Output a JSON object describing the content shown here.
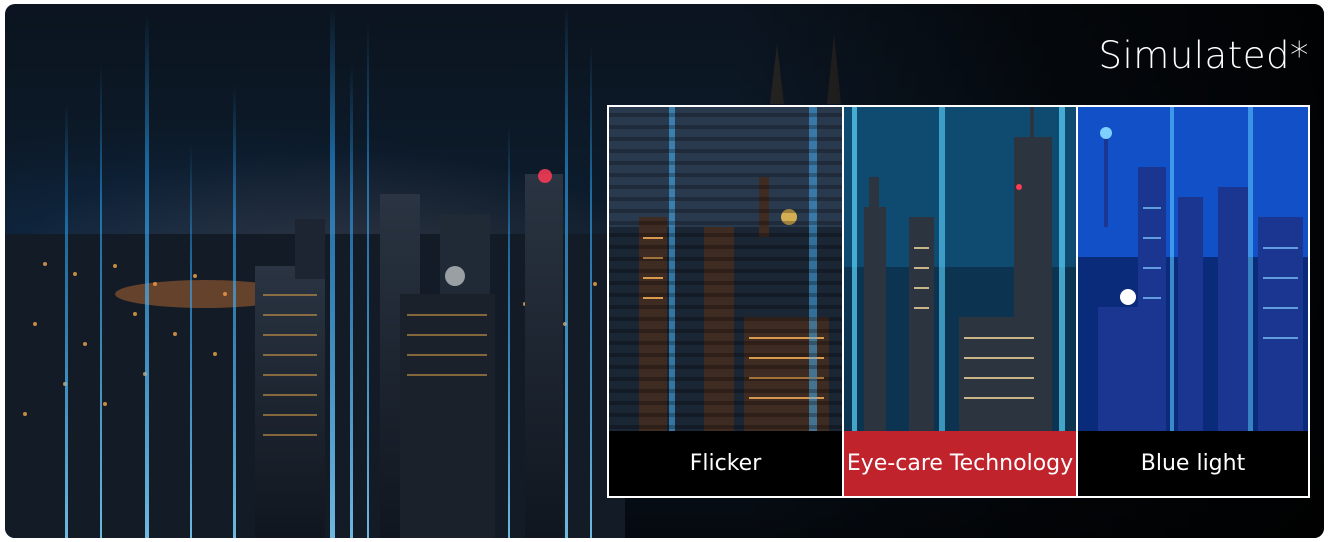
{
  "banner": {
    "note": "Simulated*"
  },
  "comparison": {
    "panels": [
      {
        "label": "Flicker"
      },
      {
        "label": "Eye-care Technology"
      },
      {
        "label": "Blue light"
      }
    ]
  },
  "colors": {
    "background_dark": "#0b141f",
    "highlight_red": "#c0232c",
    "label_black": "#000000",
    "border_white": "#ffffff",
    "city_glow_blue": "#1ea0ff",
    "city_glow_orange": "#ff9a3c"
  }
}
